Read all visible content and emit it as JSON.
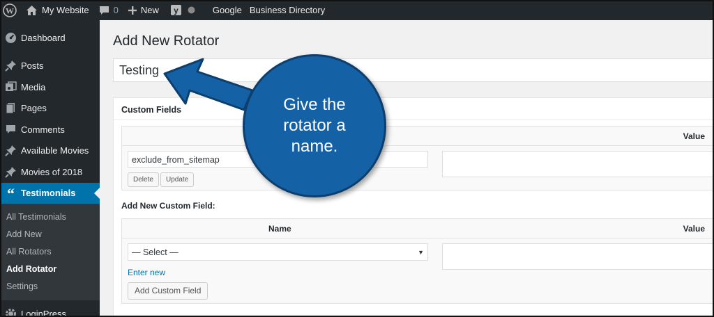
{
  "admin_bar": {
    "site_name": "My Website",
    "comments_count": "0",
    "new_label": "New",
    "google_label": "Google",
    "business_directory_label": "Business Directory"
  },
  "sidebar": {
    "items": [
      {
        "label": "Dashboard",
        "icon": "dashboard-icon"
      },
      {
        "label": "Posts",
        "icon": "pin-icon"
      },
      {
        "label": "Media",
        "icon": "media-icon"
      },
      {
        "label": "Pages",
        "icon": "pages-icon"
      },
      {
        "label": "Comments",
        "icon": "comments-icon"
      },
      {
        "label": "Available Movies",
        "icon": "pin-icon"
      },
      {
        "label": "Movies of 2018",
        "icon": "pin-icon"
      },
      {
        "label": "Testimonials",
        "icon": "quote-icon"
      }
    ],
    "submenu": [
      "All Testimonials",
      "Add New",
      "All Rotators",
      "Add Rotator",
      "Settings"
    ],
    "bottom_item": {
      "label": "LoginPress",
      "icon": "gear-icon"
    }
  },
  "main": {
    "page_title": "Add New Rotator",
    "title_value": "Testing",
    "custom_fields": {
      "title": "Custom Fields",
      "value_header": "Value",
      "existing_key": "exclude_from_sitemap",
      "delete_label": "Delete",
      "update_label": "Update"
    },
    "add_new": {
      "title": "Add New Custom Field:",
      "name_header": "Name",
      "value_header": "Value",
      "select_value": "— Select —",
      "enter_new_label": "Enter new",
      "add_button_label": "Add Custom Field"
    }
  },
  "callout": {
    "text": "Give the rotator a name."
  },
  "colors": {
    "admin_dark": "#23282d",
    "accent_blue": "#0073aa",
    "callout_blue": "#1561a6"
  }
}
